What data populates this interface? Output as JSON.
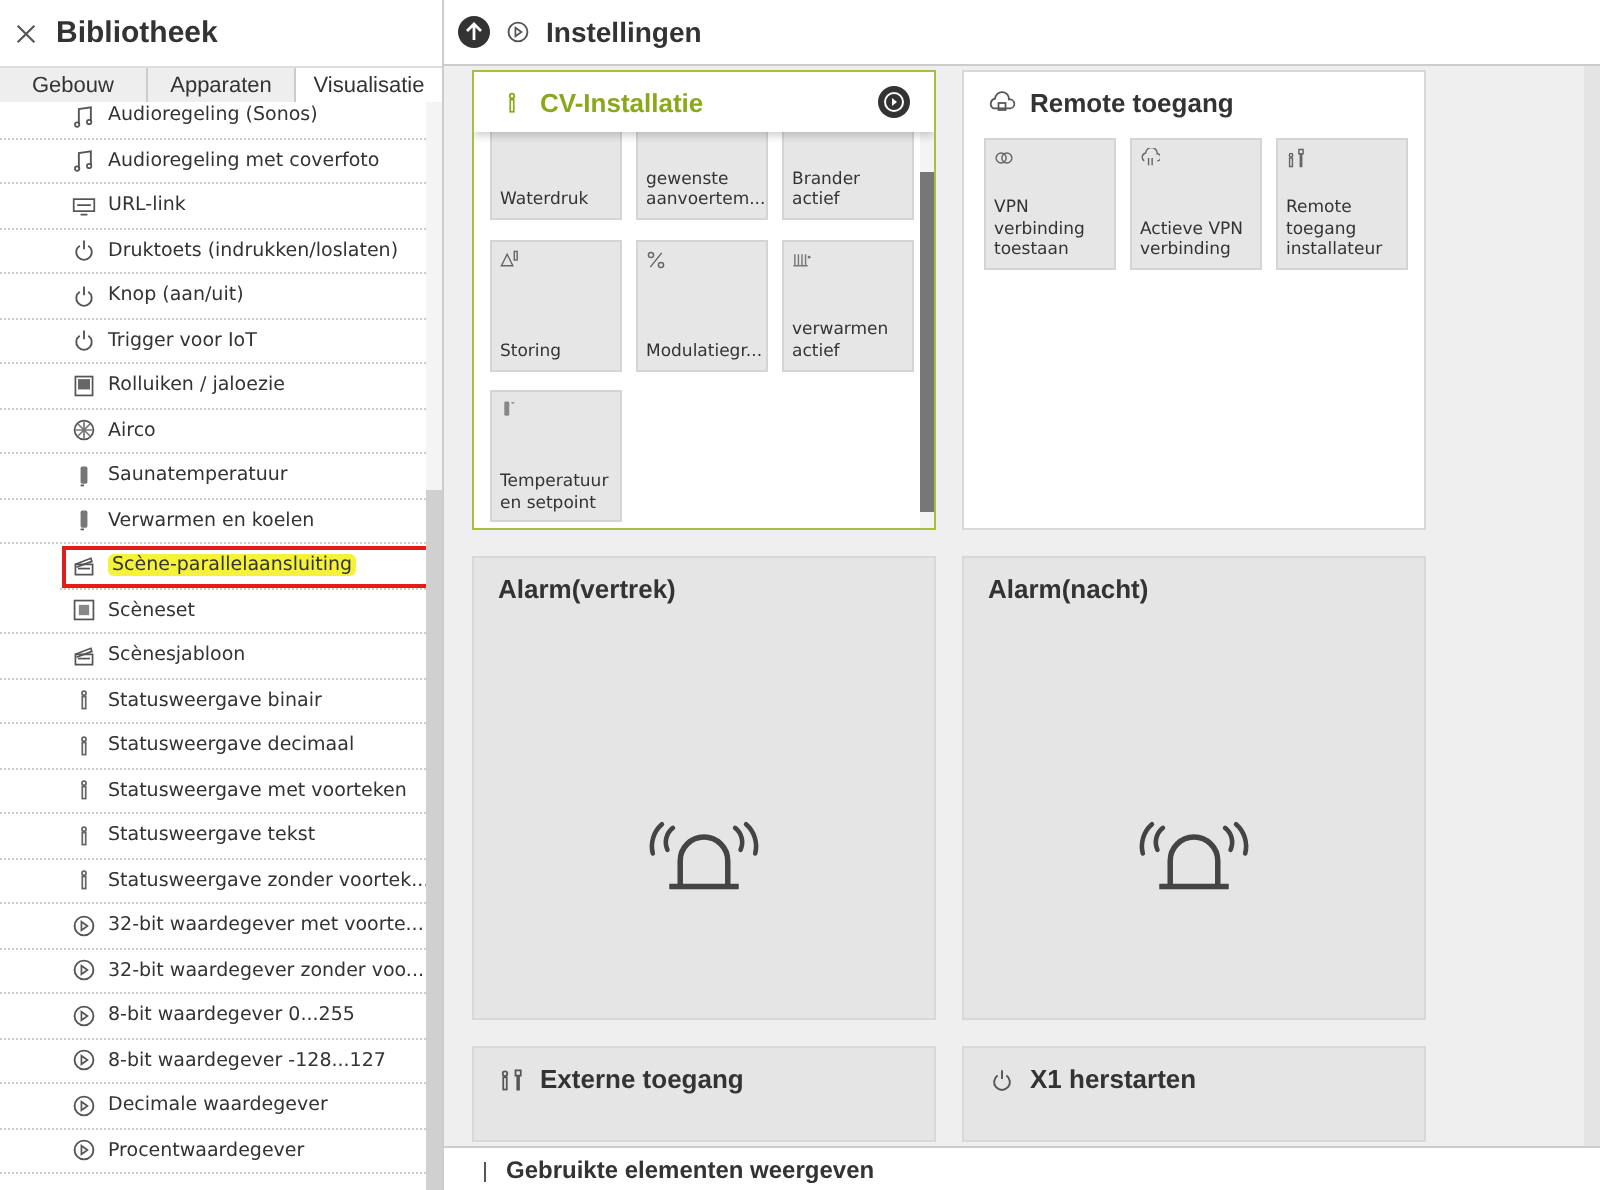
{
  "sidebar": {
    "title": "Bibliotheek",
    "tabs": [
      {
        "label": "Gebouw",
        "selected": false
      },
      {
        "label": "Apparaten",
        "selected": false
      },
      {
        "label": "Visualisatie",
        "selected": true
      }
    ],
    "items": [
      {
        "label": "Audioregeling (Sonos)",
        "kind": "music",
        "highlighted": false
      },
      {
        "label": "Audioregeling met coverfoto",
        "kind": "music",
        "highlighted": false
      },
      {
        "label": "URL-link",
        "kind": "link",
        "highlighted": false
      },
      {
        "label": "Druktoets (indrukken/loslaten)",
        "kind": "power",
        "highlighted": false
      },
      {
        "label": "Knop (aan/uit)",
        "kind": "power",
        "highlighted": false
      },
      {
        "label": "Trigger voor IoT",
        "kind": "power",
        "highlighted": false
      },
      {
        "label": "Rolluiken / jaloezie",
        "kind": "blind",
        "highlighted": false
      },
      {
        "label": "Airco",
        "kind": "fan",
        "highlighted": false
      },
      {
        "label": "Saunatemperatuur",
        "kind": "thermo",
        "highlighted": false
      },
      {
        "label": "Verwarmen en koelen",
        "kind": "thermo",
        "highlighted": false
      },
      {
        "label": "Scène-parallelaansluiting",
        "kind": "scene",
        "highlighted": true
      },
      {
        "label": "Scèneset",
        "kind": "sceneset",
        "highlighted": false
      },
      {
        "label": "Scènesjabloon",
        "kind": "scene",
        "highlighted": false
      },
      {
        "label": "Statusweergave binair",
        "kind": "status",
        "highlighted": false
      },
      {
        "label": "Statusweergave decimaal",
        "kind": "status",
        "highlighted": false
      },
      {
        "label": "Statusweergave met voorteken",
        "kind": "status",
        "highlighted": false
      },
      {
        "label": "Statusweergave tekst",
        "kind": "status",
        "highlighted": false
      },
      {
        "label": "Statusweergave zonder voortek...",
        "kind": "status",
        "highlighted": false
      },
      {
        "label": "32-bit waardegever met voorte...",
        "kind": "dial",
        "highlighted": false
      },
      {
        "label": "32-bit waardegever zonder voo...",
        "kind": "dial",
        "highlighted": false
      },
      {
        "label": "8-bit waardegever 0...255",
        "kind": "dial",
        "highlighted": false
      },
      {
        "label": "8-bit waardegever -128...127",
        "kind": "dial",
        "highlighted": false
      },
      {
        "label": "Decimale waardegever",
        "kind": "dial",
        "highlighted": false
      },
      {
        "label": "Procentwaardegever",
        "kind": "dial",
        "highlighted": false
      }
    ]
  },
  "header": {
    "title": "Instellingen"
  },
  "cards": [
    {
      "title": "CV-Installatie",
      "kind": "status",
      "selected": true,
      "tiles": [
        {
          "label": "Waterdruk",
          "kind": "none"
        },
        {
          "label": "gewenste aanvoertem...",
          "kind": "none"
        },
        {
          "label": "Brander actief",
          "kind": "none"
        },
        {
          "label": "Storing",
          "kind": "warning"
        },
        {
          "label": "Modulatiegr...",
          "kind": "percent"
        },
        {
          "label": "verwarmen actief",
          "kind": "heater"
        },
        {
          "label": "Temperatuur en setpoint",
          "kind": "thermo"
        }
      ]
    },
    {
      "title": "Remote toegang",
      "kind": "cloud",
      "selected": false,
      "tiles": [
        {
          "label": "VPN verbinding toestaan",
          "kind": "rings"
        },
        {
          "label": "Actieve VPN verbinding",
          "kind": "cloud"
        },
        {
          "label": "Remote toegang installateur",
          "kind": "tools"
        }
      ]
    },
    {
      "title": "Alarm(vertrek)",
      "kind": "alarm",
      "selected": false
    },
    {
      "title": "Alarm(nacht)",
      "kind": "alarm",
      "selected": false
    },
    {
      "title": "Externe toegang",
      "kind": "tools",
      "selected": false
    },
    {
      "title": "X1 herstarten",
      "kind": "power",
      "selected": false
    }
  ],
  "footer": {
    "label": "Gebruikte elementen weergeven"
  }
}
